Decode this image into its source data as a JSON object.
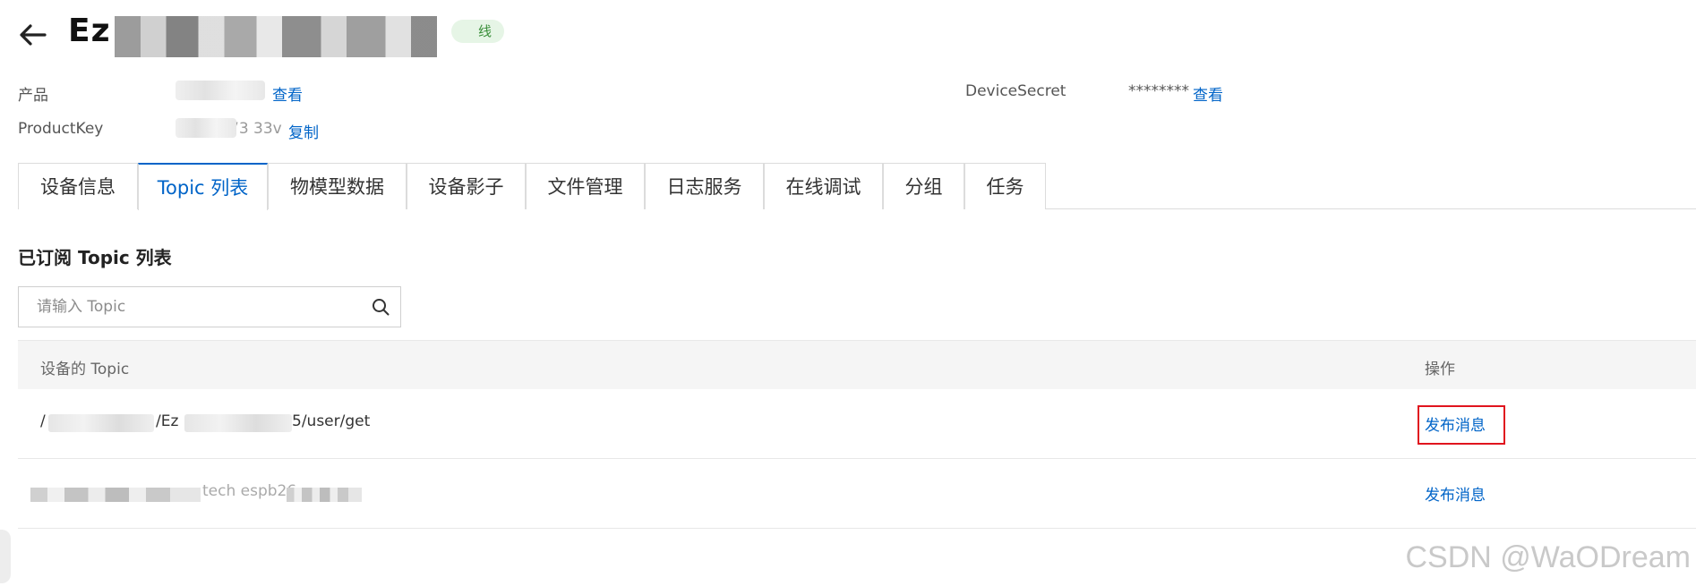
{
  "header": {
    "title_prefix": "Ez",
    "status_fragment": "线"
  },
  "info": {
    "product_label": "产品",
    "product_link": "查看",
    "productkey_label": "ProductKey",
    "productkey_partial": "73 33v",
    "productkey_copy": "复制",
    "devicesecret_label": "DeviceSecret",
    "devicesecret_value": "********",
    "devicesecret_link": "查看"
  },
  "tabs": [
    {
      "label": "设备信息"
    },
    {
      "label": "Topic 列表"
    },
    {
      "label": "物模型数据"
    },
    {
      "label": "设备影子"
    },
    {
      "label": "文件管理"
    },
    {
      "label": "日志服务"
    },
    {
      "label": "在线调试"
    },
    {
      "label": "分组"
    },
    {
      "label": "任务"
    }
  ],
  "section": {
    "title": "已订阅 Topic 列表",
    "search_placeholder": "请输入 Topic"
  },
  "table": {
    "headers": {
      "topic": "设备的 Topic",
      "action": "操作"
    },
    "rows": [
      {
        "topic_start": "/",
        "topic_mid": "/Ez",
        "topic_end": "5/user/get",
        "action": "发布消息"
      },
      {
        "topic_visible": "tech espb26",
        "action": "发布消息"
      }
    ]
  },
  "watermark": "CSDN @WaODream",
  "colors": {
    "accent": "#0064c8",
    "highlight": "#e0141e"
  }
}
